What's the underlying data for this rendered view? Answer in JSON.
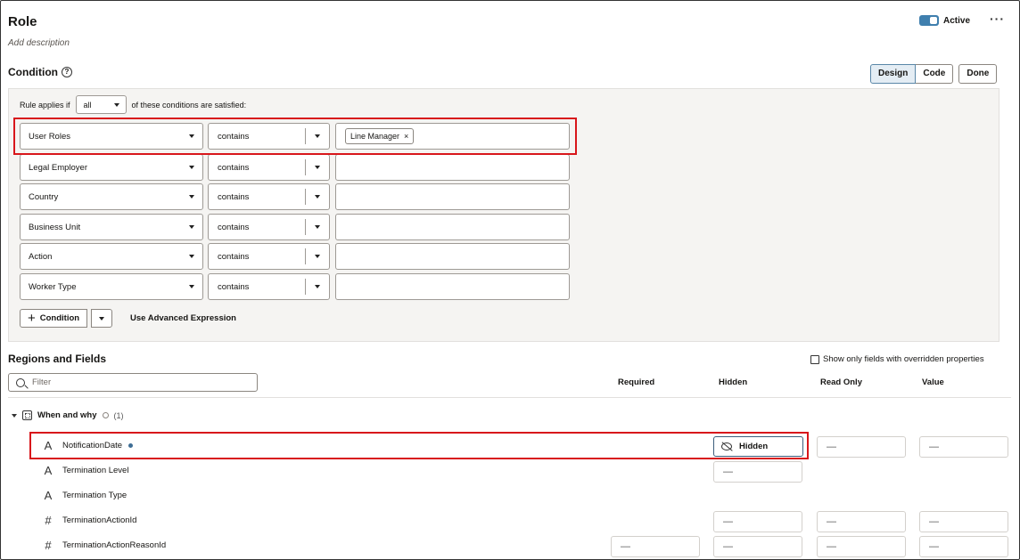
{
  "header": {
    "title": "Role",
    "description_placeholder": "Add description",
    "active_label": "Active",
    "more_label": "···"
  },
  "condition": {
    "title": "Condition",
    "help_glyph": "?",
    "view_buttons": [
      "Design",
      "Code"
    ],
    "done_label": "Done",
    "rule_prefix": "Rule applies if",
    "rule_match": "all",
    "rule_suffix": "of these conditions are satisfied:",
    "rows": [
      {
        "field": "User Roles",
        "operator": "contains",
        "values": [
          "Line Manager"
        ]
      },
      {
        "field": "Legal Employer",
        "operator": "contains",
        "values": []
      },
      {
        "field": "Country",
        "operator": "contains",
        "values": []
      },
      {
        "field": "Business Unit",
        "operator": "contains",
        "values": []
      },
      {
        "field": "Action",
        "operator": "contains",
        "values": []
      },
      {
        "field": "Worker Type",
        "operator": "contains",
        "values": []
      }
    ],
    "chip_remove": "×",
    "add_condition_label": "Condition",
    "advanced_label": "Use Advanced Expression"
  },
  "regions": {
    "title": "Regions and Fields",
    "overridden_label": "Show only fields with overridden properties",
    "filter_placeholder": "Filter",
    "columns": [
      "Required",
      "Hidden",
      "Read Only",
      "Value"
    ],
    "region_name": "When and why",
    "region_count": "(1)",
    "hidden_button_label": "Hidden",
    "empty_glyph": "—",
    "fields": [
      {
        "type_icon": "text-type-icon",
        "glyph": "A",
        "name": "NotificationDate"
      },
      {
        "type_icon": "text-type-icon",
        "glyph": "A",
        "name": "Termination Level"
      },
      {
        "type_icon": "text-type-icon",
        "glyph": "A",
        "name": "Termination Type"
      },
      {
        "type_icon": "number-type-icon",
        "glyph": "#",
        "name": "TerminationActionId"
      },
      {
        "type_icon": "number-type-icon",
        "glyph": "#",
        "name": "TerminationActionReasonId"
      }
    ]
  },
  "colors": {
    "accent": "#3f7fae",
    "highlight_border": "#d8161b",
    "panel_bg": "#f5f4f2"
  }
}
